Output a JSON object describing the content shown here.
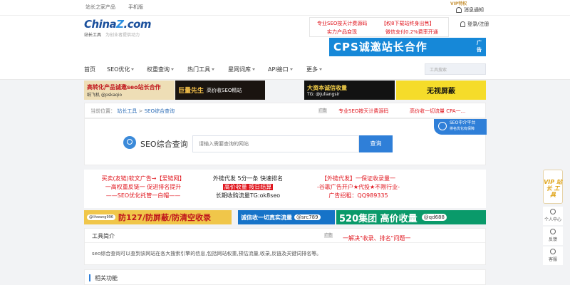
{
  "topbar": {
    "link1": "站长之家产品",
    "link2": "手机版",
    "vip": "VIP特权",
    "messages": "消息通知"
  },
  "header": {
    "logo_main": "China",
    "logo_z": "Z",
    "logo_tail": ".com",
    "logo_sub": "站长工具",
    "logo_slogan": "为创业者提供动力",
    "ad_a": "专业SEO按天计费源码",
    "ad_b": "实力产品变现",
    "ad_c": "【权8下载站终身出售】",
    "ad_d": "微信支付0.2%费率开通",
    "login": "登录/注册",
    "cps_text": "CPS诚邀站长合作",
    "cps_tag": "广告"
  },
  "nav": {
    "items": [
      "首页",
      "SEO优化",
      "权重查询",
      "热门工具",
      "星网词库",
      "API接口",
      "更多"
    ],
    "search_placeholder": "工具搜索"
  },
  "banners1": {
    "b1_title": "高转化产品诚邀seo站长合作",
    "b1_sub": "纸飞机 @pskaqio",
    "b2_title": "巨量先生",
    "b2_sub": "高价收SEO精站",
    "b3_title": "大资本诚信收量",
    "b3_sub": "TG: @juliangsir",
    "b4_title": "无视屏蔽"
  },
  "breadcrumb": {
    "label": "当前位置：",
    "l1": "站长工具",
    "sep": ">",
    "l2": "SEO综合查询",
    "ad1": "专业SEO按天计费源码",
    "ad2": "高价收一切流量 CPA一..."
  },
  "search": {
    "title": "SEO综合查询",
    "placeholder": "请输入需要查询的网站",
    "button": "查询",
    "badge1": "SEO中介平台",
    "badge2": "排名优化有保障"
  },
  "textads": {
    "col1": [
      "买卖(友链)软文广告→【爱链网】",
      "一高权重反链一 促进排名提升",
      "——SEO优化托管一白帽——"
    ],
    "col2": [
      "外链代发 5分一条 快速排名",
      "高价收量 按日结算",
      "长期收购流量TG:ok8seo"
    ],
    "col3": [
      "【外链代发】一保证收录量一",
      "-谷歌广告开户★代投★不限行业-",
      "广告招租：QQ989335"
    ]
  },
  "banners2": {
    "c1_tag": "@lihwang996",
    "c1_title": "防127/防屏蔽/防清空收录",
    "c2_title": "诚信收一切真实流量",
    "c2_tag": "@src789",
    "c3_title": "520集团 高价收量",
    "c3_tag": "@qd688"
  },
  "intro": {
    "heading": "工具简介",
    "text": "seo综合查询可以查到该网站在各大搜索引擎的信息,包括网站权重,预估流量,收录,反链及关键词排名等。",
    "red_ad": "一解决\"收录、排名\"问题一"
  },
  "related": {
    "heading": "相关功能"
  },
  "float": {
    "vip": "VIP 站长 工具",
    "items": [
      "个人中心",
      "反馈",
      "客服"
    ]
  },
  "ad_tag": "广告"
}
